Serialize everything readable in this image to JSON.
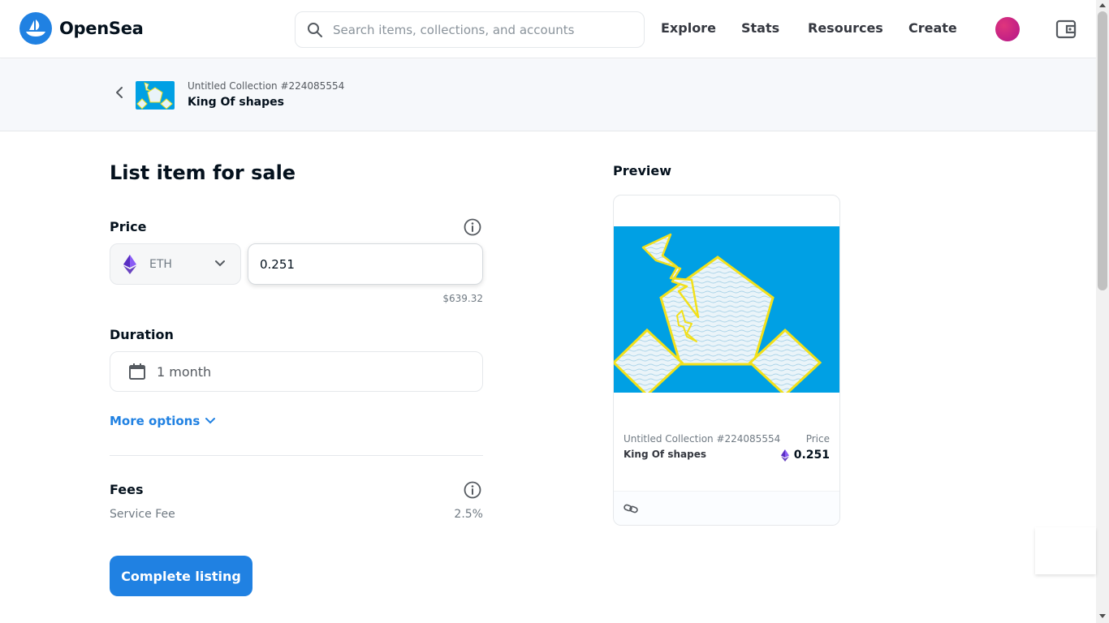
{
  "header": {
    "brand": "OpenSea",
    "search_placeholder": "Search items, collections, and accounts",
    "nav": [
      "Explore",
      "Stats",
      "Resources",
      "Create"
    ]
  },
  "breadcrumb": {
    "collection": "Untitled Collection #224085554",
    "item_name": "King Of shapes"
  },
  "form": {
    "heading": "List item for sale",
    "price_label": "Price",
    "currency": "ETH",
    "price_value": "0.251",
    "usd_value": "$639.32",
    "duration_label": "Duration",
    "duration_value": "1 month",
    "more_options": "More options",
    "fees_label": "Fees",
    "service_fee_label": "Service Fee",
    "service_fee_value": "2.5%",
    "submit": "Complete listing"
  },
  "preview": {
    "title": "Preview",
    "collection": "Untitled Collection #224085554",
    "item_name": "King Of shapes",
    "price_label": "Price",
    "price": "0.251"
  },
  "colors": {
    "accent": "#2081e2",
    "image_bg": "#00a0e4",
    "eth": "#6b46c1"
  }
}
